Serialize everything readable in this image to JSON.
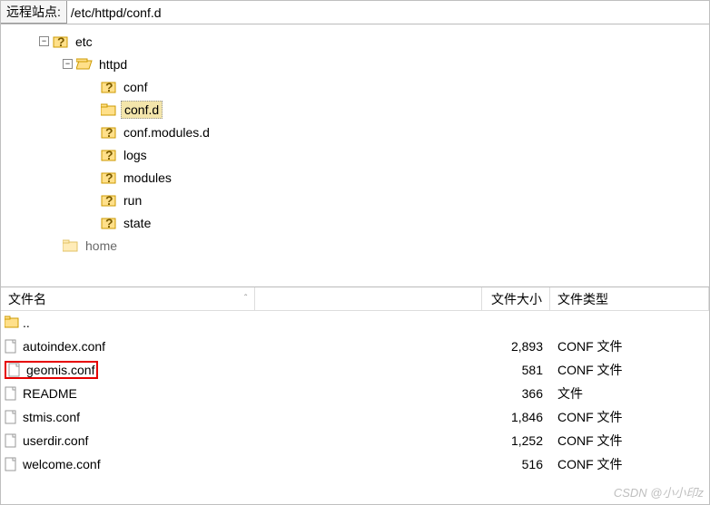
{
  "topbar": {
    "label": "远程站点:",
    "path": "/etc/httpd/conf.d"
  },
  "tree": {
    "etc": "etc",
    "httpd": "httpd",
    "conf": "conf",
    "confd": "conf.d",
    "confmod": "conf.modules.d",
    "logs": "logs",
    "modules": "modules",
    "run": "run",
    "state": "state",
    "home": "home",
    "expander_minus": "−",
    "expander_plus": "+"
  },
  "headers": {
    "name": "文件名",
    "size": "文件大小",
    "type": "文件类型",
    "sort": "ˆ"
  },
  "files": {
    "updir": "..",
    "r0": {
      "name": "autoindex.conf",
      "size": "2,893",
      "type": "CONF 文件"
    },
    "r1": {
      "name": "geomis.conf",
      "size": "581",
      "type": "CONF 文件"
    },
    "r2": {
      "name": "README",
      "size": "366",
      "type": "文件"
    },
    "r3": {
      "name": "stmis.conf",
      "size": "1,846",
      "type": "CONF 文件"
    },
    "r4": {
      "name": "userdir.conf",
      "size": "1,252",
      "type": "CONF 文件"
    },
    "r5": {
      "name": "welcome.conf",
      "size": "516",
      "type": "CONF 文件"
    }
  },
  "watermark": "CSDN @小小印z"
}
